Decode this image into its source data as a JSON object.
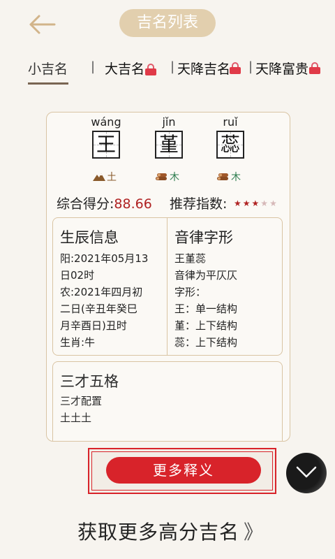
{
  "header": {
    "title": "吉名列表"
  },
  "tabs": [
    {
      "label": "小吉名",
      "locked": false
    },
    {
      "label": "大吉名",
      "locked": true
    },
    {
      "label": "天降吉名",
      "locked": true
    },
    {
      "label": "天降富贵",
      "locked": true
    }
  ],
  "tab_separator": "|",
  "name": {
    "chars": [
      {
        "pinyin": "wáng",
        "char": "王",
        "element": "土",
        "element_icon": "mountain-icon"
      },
      {
        "pinyin": "jǐn",
        "char": "堇",
        "element": "木",
        "element_icon": "wood-logs-icon"
      },
      {
        "pinyin": "ruǐ",
        "char": "蕊",
        "element": "木",
        "element_icon": "wood-logs-icon"
      }
    ],
    "score_label": "综合得分:",
    "score_value": "88.66",
    "recommend_label": "推荐指数:",
    "stars": {
      "filled": 3,
      "total": 5
    }
  },
  "birth_info": {
    "title": "生辰信息",
    "lines": [
      "阳:2021年05月13",
      "日02时",
      "农:2021年四月初",
      "二日(辛丑年癸巳",
      "月辛酉日)丑时",
      "生肖:牛"
    ]
  },
  "phonetic": {
    "title": "音律字形",
    "lines": [
      "王堇蕊",
      "音律为平仄仄",
      "字形：",
      "王：单一结构",
      "堇：上下结构",
      "蕊：上下结构"
    ]
  },
  "sancai": {
    "title": "三才五格",
    "lines": [
      "三才配置",
      "土土土"
    ]
  },
  "more_button": {
    "label": "更多释义"
  },
  "bottom_link": {
    "label": "获取更多高分吉名",
    "chevron": "》"
  },
  "colors": {
    "accent_red": "#d8232a",
    "score_red": "#b02323",
    "pill": "#e2cfae",
    "gold_border": "#d9c4a3",
    "element_wood": "#2e7d4f",
    "element_earth": "#8a5a2b"
  }
}
